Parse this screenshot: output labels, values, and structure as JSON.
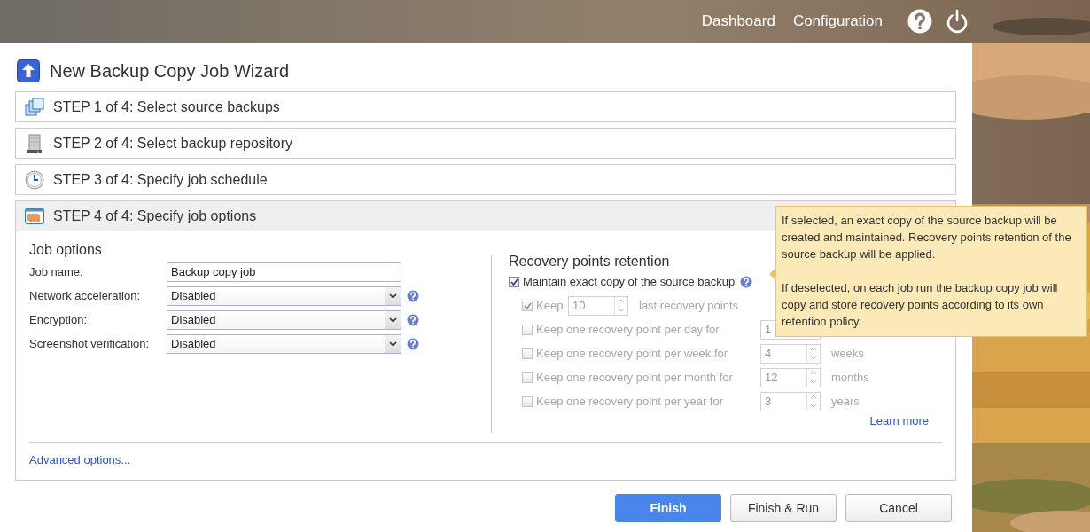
{
  "header": {
    "nav": [
      {
        "label": "Dashboard"
      },
      {
        "label": "Configuration"
      }
    ]
  },
  "wizard": {
    "title": "New Backup Copy Job Wizard",
    "steps": [
      {
        "label": "STEP 1 of 4: Select source backups",
        "expanded": false
      },
      {
        "label": "STEP 2 of 4: Select backup repository",
        "expanded": false
      },
      {
        "label": "STEP 3 of 4: Specify job schedule",
        "expanded": false
      },
      {
        "label": "STEP 4 of 4: Specify job options",
        "expanded": true
      }
    ]
  },
  "job_options": {
    "heading": "Job options",
    "fields": [
      {
        "kind": "text",
        "label": "Job name:",
        "value": "Backup copy job"
      },
      {
        "kind": "select",
        "label": "Network acceleration:",
        "value": "Disabled"
      },
      {
        "kind": "select",
        "label": "Encryption:",
        "value": "Disabled"
      },
      {
        "kind": "select",
        "label": "Screenshot verification:",
        "value": "Disabled"
      }
    ],
    "advanced_link": "Advanced options..."
  },
  "retention": {
    "heading": "Recovery points retention",
    "maintain": {
      "label": "Maintain exact copy of the source backup",
      "checked": true
    },
    "rows": [
      {
        "kind": "inline",
        "label": "Keep",
        "checked": true,
        "disabled": true,
        "value": "10",
        "unit": "last recovery points"
      },
      {
        "kind": "aligned",
        "label": "Keep one recovery point per day for",
        "checked": false,
        "disabled": true,
        "value": "1"
      },
      {
        "kind": "aligned",
        "label": "Keep one recovery point per week for",
        "checked": false,
        "disabled": true,
        "value": "4",
        "unit": "weeks"
      },
      {
        "kind": "aligned",
        "label": "Keep one recovery point per month for",
        "checked": false,
        "disabled": true,
        "value": "12",
        "unit": "months"
      },
      {
        "kind": "aligned",
        "label": "Keep one recovery point per year for",
        "checked": false,
        "disabled": true,
        "value": "3",
        "unit": "years"
      }
    ],
    "learn_more": "Learn more"
  },
  "tooltip": {
    "paragraphs": [
      "If selected, an exact copy of the source backup will be created and maintained. Recovery points retention of the source backup will be applied.",
      "If deselected, on each job run the backup copy job will copy and store recovery points according to its own retention policy."
    ]
  },
  "buttons": [
    {
      "label": "Finish",
      "primary": true
    },
    {
      "label": "Finish & Run",
      "primary": false
    },
    {
      "label": "Cancel",
      "primary": false
    }
  ]
}
